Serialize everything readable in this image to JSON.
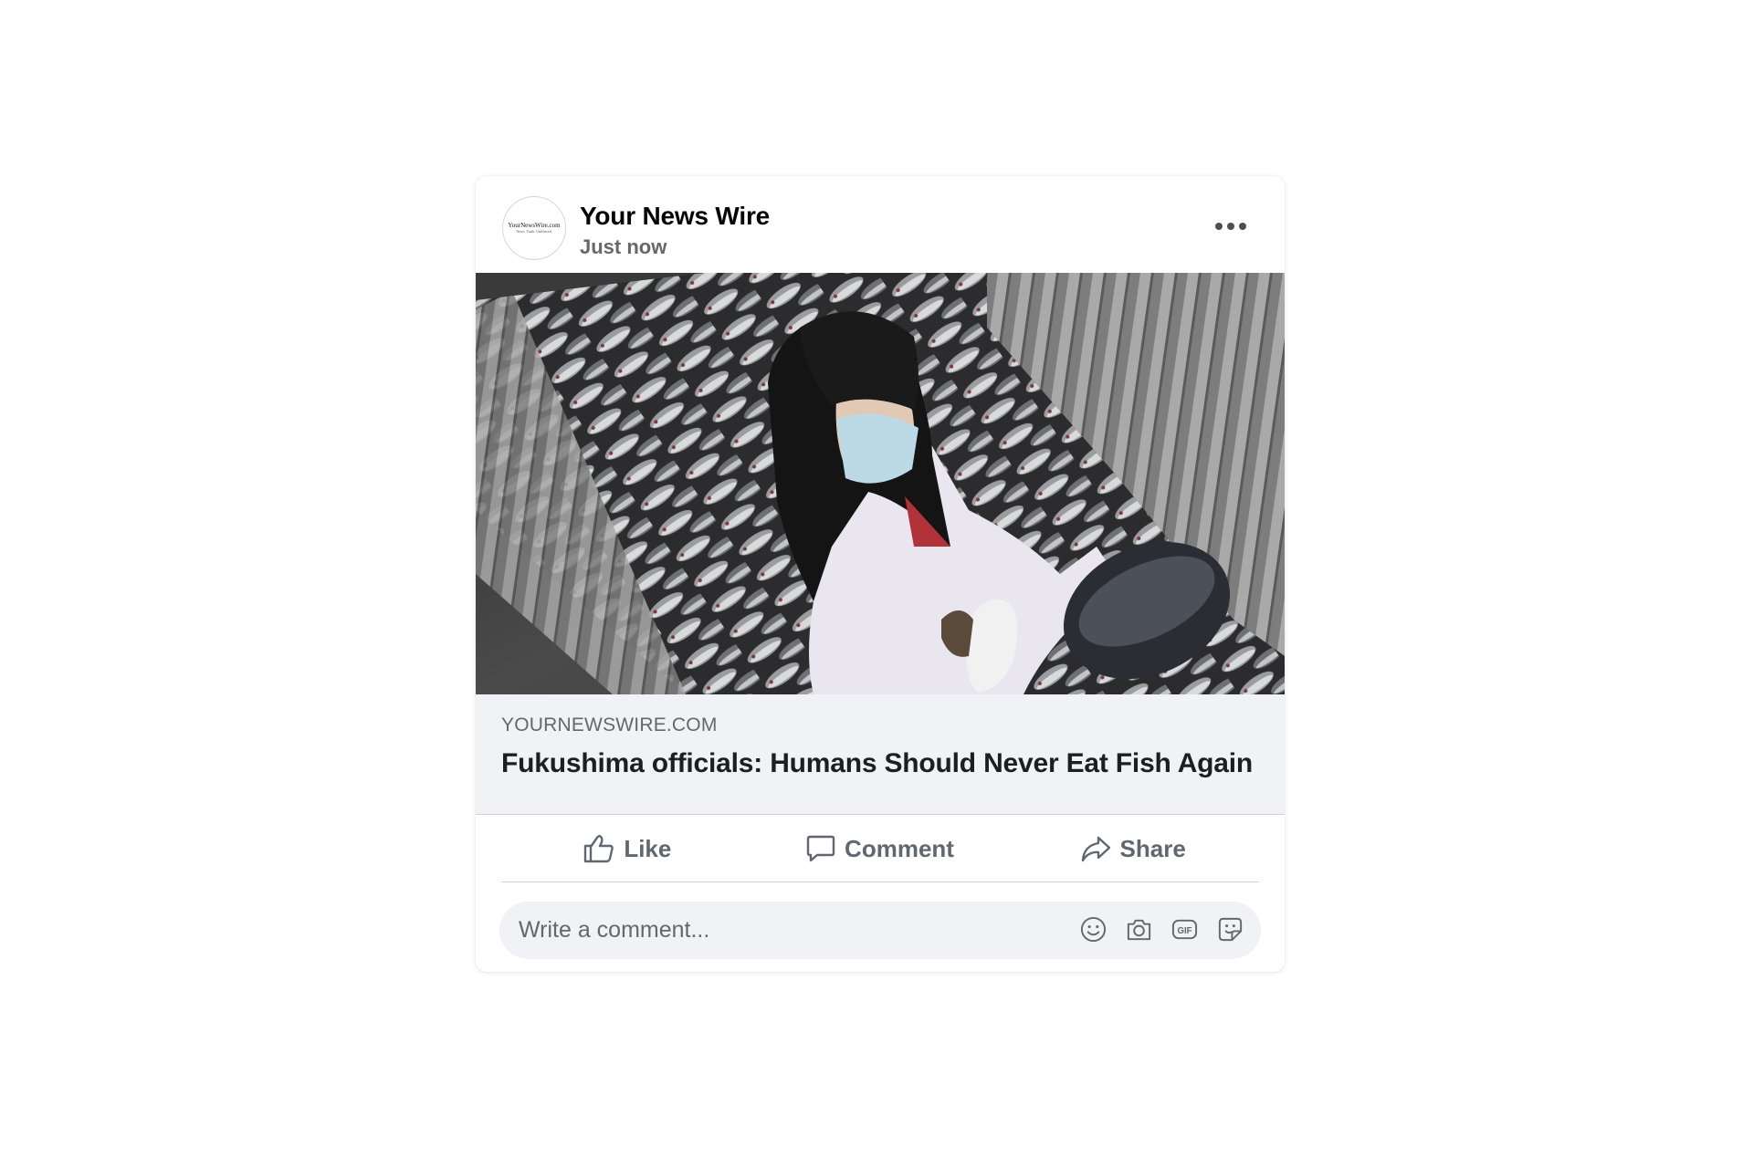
{
  "post": {
    "page_name": "Your News Wire",
    "timestamp": "Just now",
    "avatar": {
      "logo_text": "YourNewsWire.com",
      "tagline": "News. Truth. Unfiltered."
    },
    "more_icon": "more-horizontal-icon",
    "photo": {
      "alt": "Person in mask and lab coat holding a fish over a container of fish"
    }
  },
  "link_preview": {
    "domain": "YOURNEWSWIRE.COM",
    "title": "Fukushima officials: Humans Should Never Eat Fish Again"
  },
  "actions": [
    {
      "label": "Like",
      "icon": "thumbs-up-icon"
    },
    {
      "label": "Comment",
      "icon": "comment-bubble-icon"
    },
    {
      "label": "Share",
      "icon": "share-arrow-icon"
    }
  ],
  "comment": {
    "placeholder": "Write a comment...",
    "icons": [
      "emoji-icon",
      "camera-icon",
      "gif-icon",
      "sticker-icon"
    ],
    "gif_label": "GIF"
  },
  "colors": {
    "text_primary": "#050505",
    "text_secondary": "#65676b",
    "action_text": "#606770",
    "link_box_bg": "#f0f2f5",
    "divider": "#ced0d4"
  }
}
